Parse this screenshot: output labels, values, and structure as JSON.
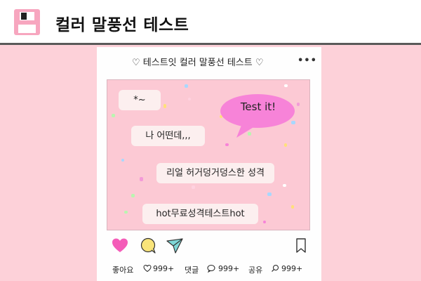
{
  "header": {
    "title": "컬러 말풍선 테스트",
    "logo_icon": "floppy-disk-icon"
  },
  "card": {
    "title": "♡ 테스트잇 컬러 말풍선 테스트 ♡",
    "more_icon": "more-horizontal-icon",
    "more_glyph": "•••"
  },
  "bubbles": {
    "b1": "*~",
    "b2": "나 어떤데,,,",
    "b3": "리얼 허거덩거덩스한 성격",
    "b4": "hot무료성격테스트hot",
    "speech": "Test it!"
  },
  "actions": {
    "like_icon": "heart-icon",
    "comment_icon": "comment-icon",
    "share_icon": "send-icon",
    "save_icon": "bookmark-icon"
  },
  "stats": {
    "likes_label": "좋아요",
    "likes_value": "999+",
    "comments_label": "댓글",
    "comments_value": "999+",
    "shares_label": "공유",
    "shares_value": "999+"
  },
  "colors": {
    "background": "#fdd1d9",
    "accent_pink": "#f783d8",
    "heart": "#f45cb8",
    "comment": "#f9e47a",
    "share": "#7fd6d6"
  }
}
